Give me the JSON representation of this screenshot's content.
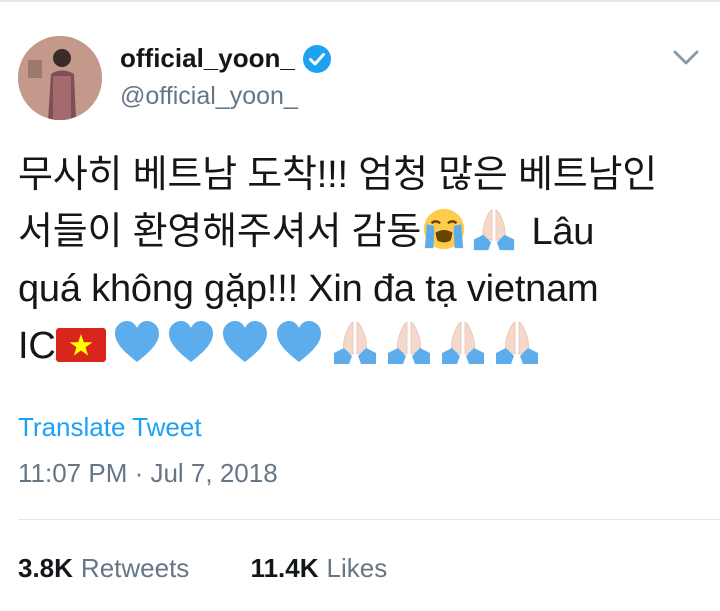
{
  "author": {
    "display_name": "official_yoon_",
    "handle": "@official_yoon_",
    "verified": true
  },
  "tweet": {
    "text_lines": [
      "무사히 베트남 도착!!! 엄청 많은 베트남인",
      "서들이 환영해주셔서 감동",
      "Lâu",
      "quá không gặp!!! Xin đa tạ vietnam",
      "IC"
    ],
    "emoji": {
      "crying_face": "loudly-crying-face-icon",
      "praying_hands": "folded-hands-icon",
      "flag": "vietnam-flag-icon",
      "heart": "blue-heart-icon"
    },
    "translate_label": "Translate Tweet",
    "timestamp": "11:07 PM · Jul 7, 2018"
  },
  "stats": {
    "retweets_count": "3.8K",
    "retweets_label": "Retweets",
    "likes_count": "11.4K",
    "likes_label": "Likes"
  },
  "colors": {
    "accent_blue": "#1da1f2",
    "secondary_text": "#657786",
    "divider": "#e1e8ed",
    "heart_blue": "#5dadec",
    "flag_red": "#da251d",
    "flag_star": "#ffff00"
  }
}
